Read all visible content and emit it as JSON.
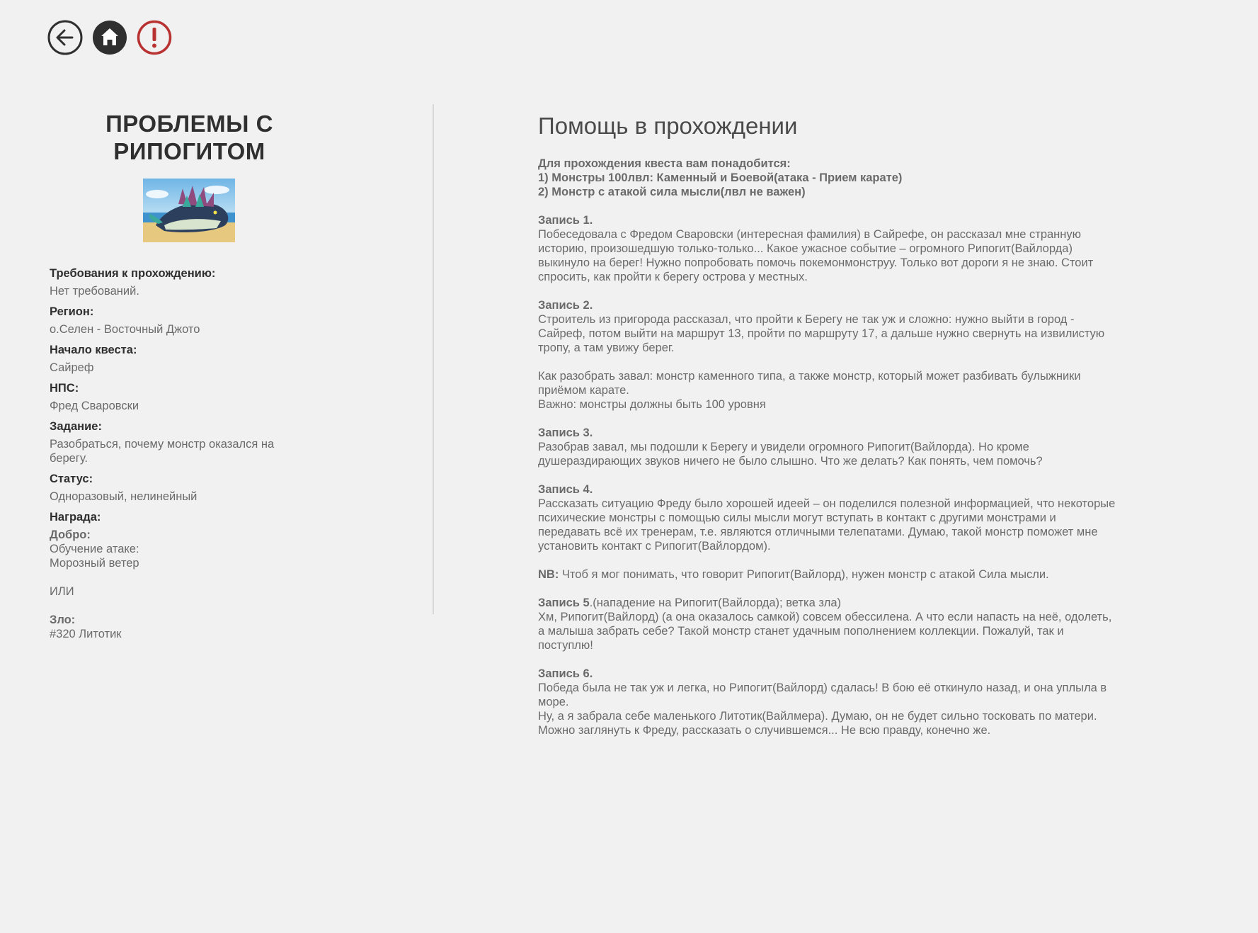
{
  "nav": {
    "back_icon": "arrow-left-circle-icon",
    "home_icon": "home-icon",
    "report_icon": "exclamation-circle-icon",
    "colors": {
      "dark": "#2f2f2f",
      "report": "#b83232"
    }
  },
  "quest": {
    "title_line1": "ПРОБЛЕМЫ С",
    "title_line2": "РИПОГИТОМ",
    "info": [
      {
        "label": "Требования к прохождению:",
        "value": "Нет требований."
      },
      {
        "label": "Регион:",
        "value": "о.Селен - Восточный Джото"
      },
      {
        "label": "Начало квеста:",
        "value": "Сайреф"
      },
      {
        "label": "НПС:",
        "value": "Фред Сваровски"
      },
      {
        "label": "Задание:",
        "value": "Разобраться, почему монстр оказался на берегу."
      },
      {
        "label": "Статус:",
        "value": "Одноразовый, нелинейный"
      }
    ],
    "reward": {
      "label": "Награда:",
      "good_label": "Добро:",
      "good_line1": "Обучение атаке:",
      "good_line2": "Морозный ветер",
      "or": "ИЛИ",
      "evil_label": "Зло:",
      "evil_value": "#320 Литотик"
    }
  },
  "help": {
    "title": "Помощь в прохождении",
    "requirements": [
      "Для прохождения квеста вам понадобится:",
      "1) Монстры 100лвл: Каменный и Боевой(атака - Прием карате)",
      "2) Монстр с атакой сила мысли(лвл не важен)"
    ],
    "entry1": {
      "label": "Запись 1.",
      "text": "Побеседовала с Фредом Сваровски (интересная фамилия) в Сайрефе, он рассказал мне странную историю, произошедшую только-только... Какое ужасное событие – огромного Рипогит(Вайлорда) выкинуло на берег! Нужно попробовать помочь покемонмонструу. Только вот дороги я не знаю. Стоит спросить, как пройти к берегу острова у местных."
    },
    "entry2": {
      "label": "Запись 2.",
      "text": "Строитель из пригорода рассказал, что пройти к Берегу не так уж и сложно: нужно выйти в город - Сайреф, потом выйти на маршрут 13, пройти по маршруту 17, а дальше нужно свернуть на извилистую тропу, а там увижу берег."
    },
    "clear_block": {
      "line1": "Как разобрать завал: монстр каменного типа, а также монстр, который может разбивать булыжники приёмом карате.",
      "line2": "Важно: монстры должны быть 100 уровня"
    },
    "entry3": {
      "label": "Запись 3.",
      "text": "Разобрав завал, мы подошли к Берегу и увидели огромного Рипогит(Вайлорда). Но кроме душераздирающих звуков ничего не было слышно. Что же делать? Как понять, чем помочь?"
    },
    "entry4": {
      "label": "Запись 4.",
      "text": "Рассказать ситуацию Фреду было хорошей идеей – он поделился полезной информацией, что некоторые психические монстры с помощью силы мысли могут вступать в контакт с другими монстрами и передавать всё их тренерам, т.е. являются отличными телепатами. Думаю, такой монстр поможет мне установить контакт с Рипогит(Вайлордом)."
    },
    "nb": {
      "label": "NB:",
      "text": " Чтоб я мог понимать, что говорит Рипогит(Вайлорд), нужен монстр с атакой Сила мысли."
    },
    "entry5": {
      "label": "Запись 5",
      "label_suffix": ".(нападение на Рипогит(Вайлорда); ветка зла)",
      "text": "Хм, Рипогит(Вайлорд) (а она оказалось самкой) совсем обессилена. А что если напасть на неё, одолеть, а малыша забрать себе? Такой монстр станет удачным пополнением коллекции. Пожалуй, так и поступлю!"
    },
    "entry6": {
      "label": "Запись 6.",
      "text1": "Победа была не так уж и легка, но Рипогит(Вайлорд) сдалась! В бою её откинуло назад, и она уплыла в море.",
      "text2": "Ну, а я забрала себе маленького Литотик(Вайлмера). Думаю, он не будет сильно тосковать по матери. Можно заглянуть к Фреду, рассказать о случившемся... Не всю правду, конечно же."
    }
  }
}
